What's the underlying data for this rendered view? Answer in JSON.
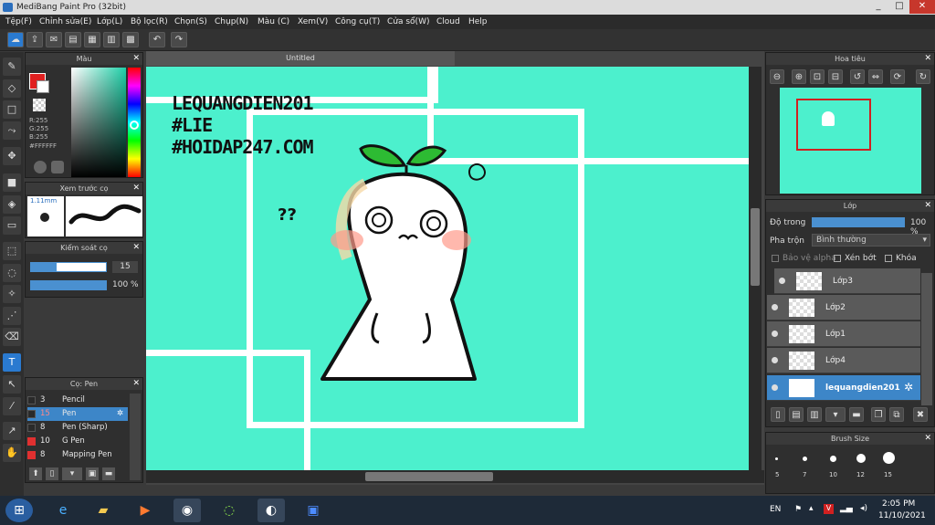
{
  "window": {
    "title": "MediBang Paint Pro (32bit)",
    "min": "_",
    "max": "□",
    "close": "✕"
  },
  "menu": [
    "Tệp(F)",
    "Chỉnh sửa(E)",
    "Lớp(L)",
    "Bộ lọc(R)",
    "Chọn(S)",
    "Chụp(N)",
    "Màu (C)",
    "Xem(V)",
    "Công cụ(T)",
    "Cửa sổ(W)",
    "Cloud",
    "Help"
  ],
  "toolbar": {
    "icons": [
      "cloud-icon",
      "share-icon",
      "chat-icon",
      "doc-icon",
      "doc2-icon",
      "doc3-icon",
      "grid-icon",
      "undo-icon",
      "redo-icon"
    ],
    "undo": "↶",
    "redo": "↷"
  },
  "color_panel": {
    "title": "Màu",
    "r": "R:255",
    "g": "G:255",
    "b": "B:255",
    "hex": "#FFFFFF"
  },
  "preview_panel": {
    "title": "Xem trước cọ",
    "size": "1.11mm"
  },
  "control_panel": {
    "title": "Kiểm soát cọ",
    "size_value": "15",
    "opacity_value": "100 %"
  },
  "brush_panel": {
    "title": "Cọ: Pen",
    "items": [
      {
        "size": "3",
        "name": "Pencil",
        "color": "#2a2a2a"
      },
      {
        "size": "15",
        "name": "Pen",
        "color": "#2a2a2a"
      },
      {
        "size": "8",
        "name": "Pen (Sharp)",
        "color": "#2a2a2a"
      },
      {
        "size": "10",
        "name": "G Pen",
        "color": "#e03030"
      },
      {
        "size": "8",
        "name": "Mapping Pen",
        "color": "#e03030"
      }
    ]
  },
  "document": {
    "tab": "Untitled",
    "text_line1": "LEQUANGDIEN201",
    "text_line2": "#LIE",
    "text_line3": "#HOIDAP247.COM",
    "marks": "??"
  },
  "navigator_panel": {
    "title": "Hoa tiêu"
  },
  "layer_panel": {
    "title": "Lớp",
    "opacity_label": "Độ trong",
    "opacity_value": "100 %",
    "blend_label": "Pha trộn",
    "blend_value": "Bình thường",
    "protect_alpha": "Bảo vệ alpha",
    "clip": "Xén bớt",
    "lock": "Khóa",
    "layers": [
      "Lớp3",
      "Lớp2",
      "Lớp1",
      "Lớp4",
      "lequangdien201"
    ]
  },
  "brushsize_panel": {
    "title": "Brush Size",
    "sizes": [
      "5",
      "7",
      "10",
      "12",
      "15"
    ]
  },
  "taskbar": {
    "lang": "EN",
    "time": "2:05 PM",
    "date": "11/10/2021"
  }
}
